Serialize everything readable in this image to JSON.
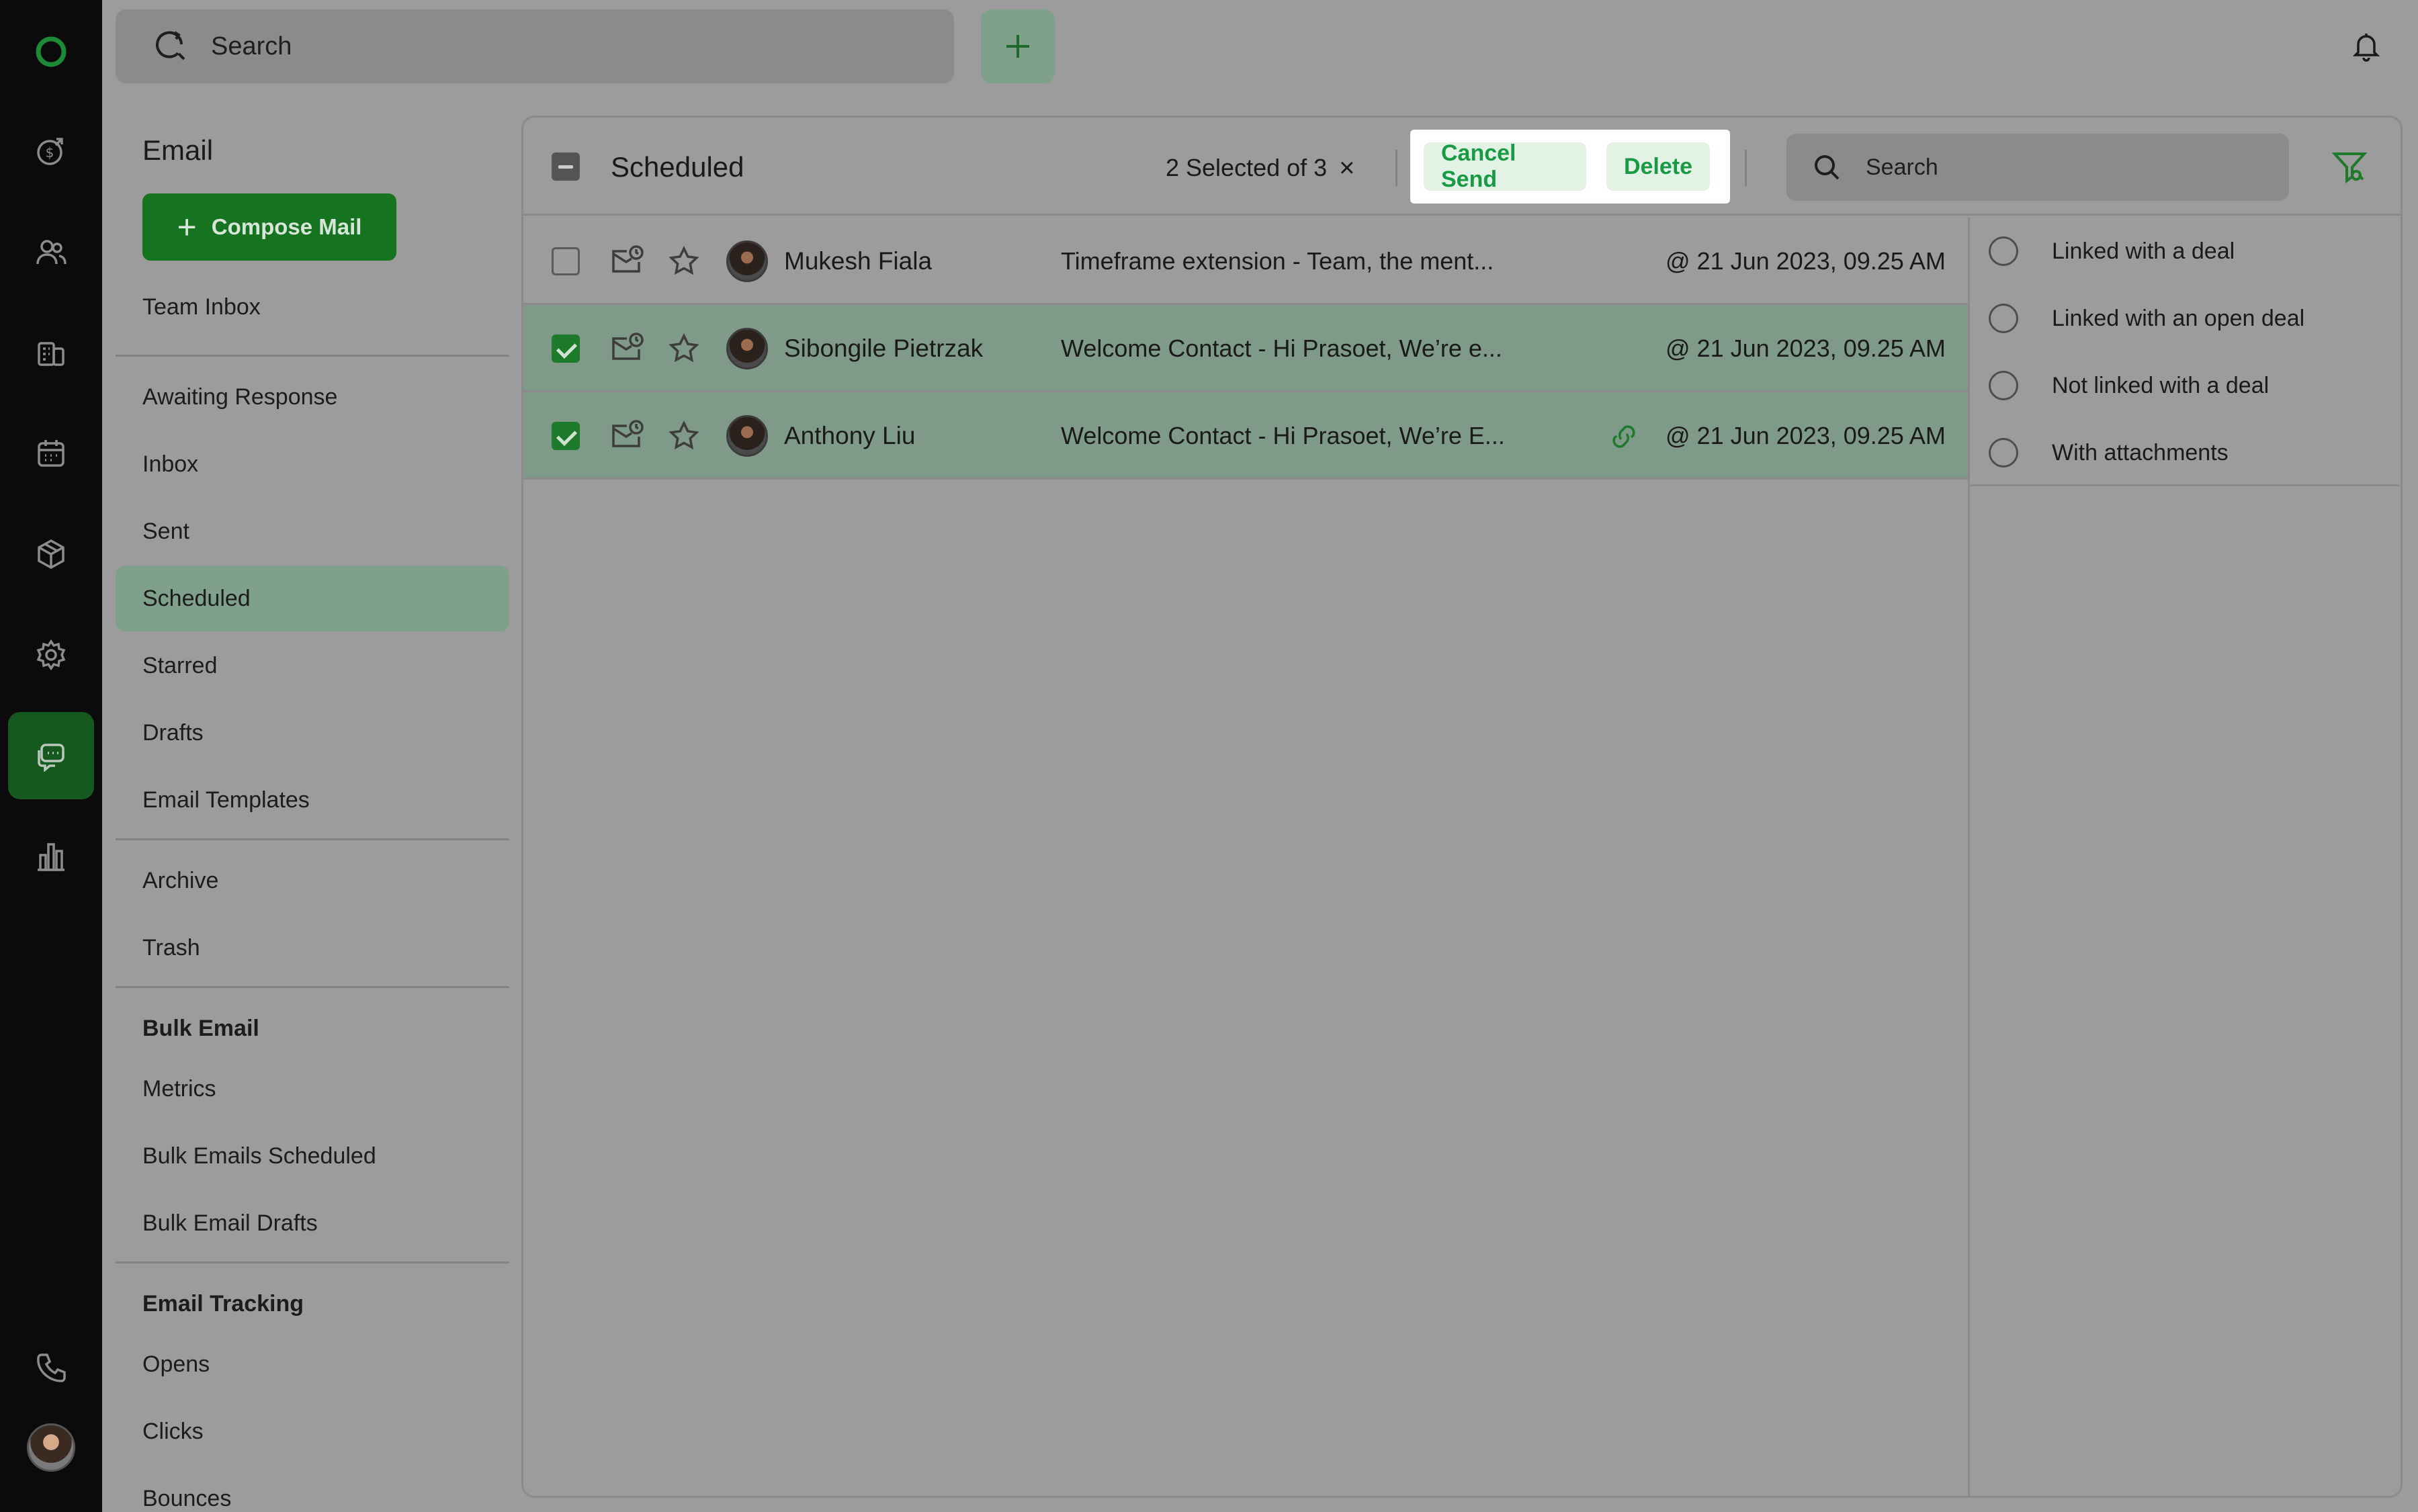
{
  "top_search": {
    "placeholder": "Search"
  },
  "nav": {
    "title": "Email",
    "compose_label": "Compose Mail",
    "team_inbox": "Team Inbox",
    "items": [
      "Awaiting Response",
      "Inbox",
      "Sent",
      "Scheduled",
      "Starred",
      "Drafts",
      "Email Templates"
    ],
    "items2": [
      "Archive",
      "Trash"
    ],
    "bulk_header": "Bulk Email",
    "bulk_items": [
      "Metrics",
      "Bulk Emails Scheduled",
      "Bulk Email Drafts"
    ],
    "tracking_header": "Email Tracking",
    "tracking_items": [
      "Opens",
      "Clicks",
      "Bounces"
    ],
    "active_item": "Scheduled"
  },
  "toolbar": {
    "title": "Scheduled",
    "selected_text": "2 Selected of 3",
    "clear_icon": "×",
    "cancel_send": "Cancel Send",
    "delete": "Delete",
    "search_placeholder": "Search"
  },
  "emails": [
    {
      "name": "Mukesh Fiala",
      "subject": "Timeframe extension  -  Team, the ment...",
      "date": "@ 21 Jun 2023, 09.25 AM",
      "selected": false,
      "linked": false
    },
    {
      "name": "Sibongile Pietrzak",
      "subject": "Welcome Contact  -  Hi Prasoet, We’re e...",
      "date": "@ 21 Jun 2023, 09.25 AM",
      "selected": true,
      "linked": false
    },
    {
      "name": "Anthony Liu",
      "subject": "Welcome Contact  -  Hi Prasoet, We’re E...",
      "date": "@ 21 Jun 2023, 09.25 AM",
      "selected": true,
      "linked": true
    }
  ],
  "filters": [
    "Linked with a deal",
    "Linked with an open deal",
    "Not linked with a deal",
    "With attachments"
  ],
  "colors": {
    "accent": "#16731f",
    "action_text": "#1a9a45",
    "action_bg": "#e2f3e6",
    "overlay_bg": "#9c9c9c",
    "rail_bg": "#0b0b0b"
  },
  "rail_icons": [
    "logo-icon",
    "deals-icon",
    "contacts-icon",
    "companies-icon",
    "calendar-icon",
    "products-icon",
    "settings-icon",
    "email-icon",
    "reports-icon",
    "phone-icon",
    "user-avatar"
  ]
}
